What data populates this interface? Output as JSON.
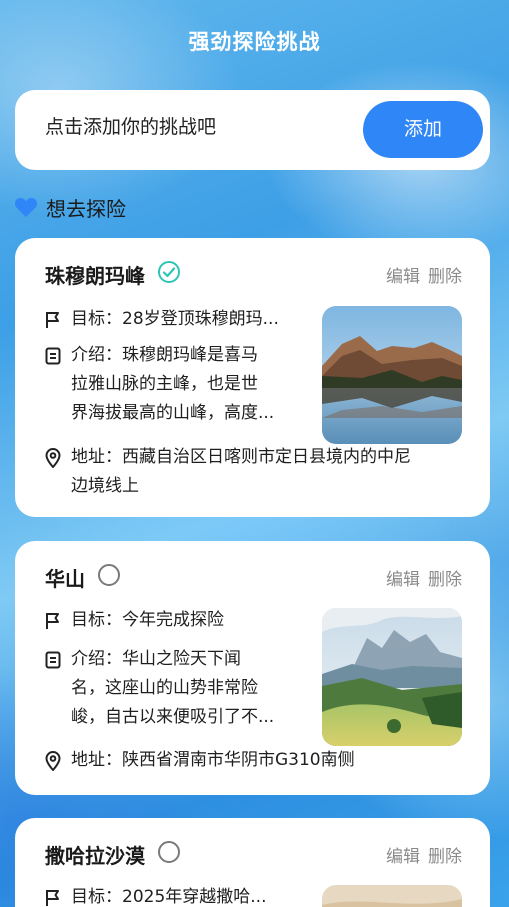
{
  "header": {
    "title": "强劲探险挑战"
  },
  "add_bar": {
    "placeholder": "点击添加你的挑战吧",
    "button_label": "添加"
  },
  "section": {
    "title": "想去探险"
  },
  "cards": [
    {
      "title": "珠穆朗玛峰",
      "completed": true,
      "edit_label": "编辑",
      "delete_label": "删除",
      "goal": "目标：28岁登顶珠穆朗玛...",
      "intro_lines": [
        "介绍：珠穆朗玛峰是喜马",
        "拉雅山脉的主峰，也是世",
        "界海拔最高的山峰，高度..."
      ],
      "address_lines": [
        "地址：西藏自治区日喀则市定日县境内的中尼",
        "边境线上"
      ],
      "image": "mountain-lake-photo"
    },
    {
      "title": "华山",
      "completed": false,
      "edit_label": "编辑",
      "delete_label": "删除",
      "goal": "目标：今年完成探险",
      "intro_lines": [
        "介绍：华山之险天下闻",
        "名，这座山的山势非常险",
        "峻，自古以来便吸引了不..."
      ],
      "address_lines": [
        "地址：陕西省渭南市华阴市G310南侧"
      ],
      "image": "mountain-meadow-photo"
    },
    {
      "title": "撒哈拉沙漠",
      "completed": false,
      "edit_label": "编辑",
      "delete_label": "删除",
      "goal": "目标：2025年穿越撒哈...",
      "image": "desert-photo"
    }
  ],
  "colors": {
    "accent": "#2f86f6",
    "check": "#2ec4b6",
    "text": "#1f1f1f",
    "muted": "#8a8a8a"
  }
}
